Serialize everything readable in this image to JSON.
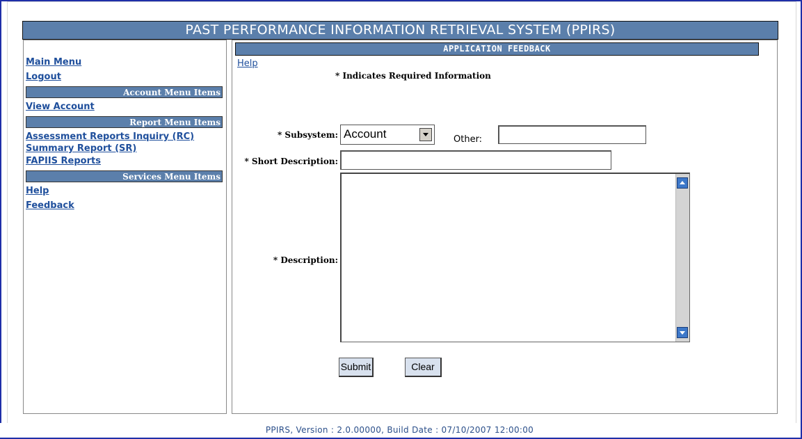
{
  "title": "PAST PERFORMANCE INFORMATION RETRIEVAL SYSTEM (PPIRS)",
  "sidebar": {
    "top_links": [
      "Main Menu",
      "Logout"
    ],
    "account_header": "Account Menu Items",
    "account_links": [
      "View Account"
    ],
    "report_header": "Report Menu Items",
    "report_links": [
      "Assessment Reports Inquiry (RC)",
      "Summary Report (SR)",
      "FAPIIS Reports"
    ],
    "services_header": "Services Menu Items",
    "services_links": [
      "Help",
      "Feedback"
    ]
  },
  "main": {
    "section_title": "APPLICATION FEEDBACK",
    "help_link": "Help",
    "required_note": "* Indicates Required Information",
    "subsystem_label": "* Subsystem:",
    "subsystem_value": "Account",
    "other_label": "Other:",
    "other_value": "",
    "short_desc_label": "* Short Description:",
    "short_desc_value": "",
    "description_label": "* Description:",
    "description_value": "",
    "submit_label": "Submit",
    "clear_label": "Clear"
  },
  "footer": {
    "text": "PPIRS, Version : 2.0.00000, Build Date : 07/10/2007 12:00:00"
  },
  "colors": {
    "header_bg": "#5b7fab",
    "link": "#1f4f9c",
    "button_bg": "#d8e1ee",
    "scroll_button": "#3d78c9"
  }
}
